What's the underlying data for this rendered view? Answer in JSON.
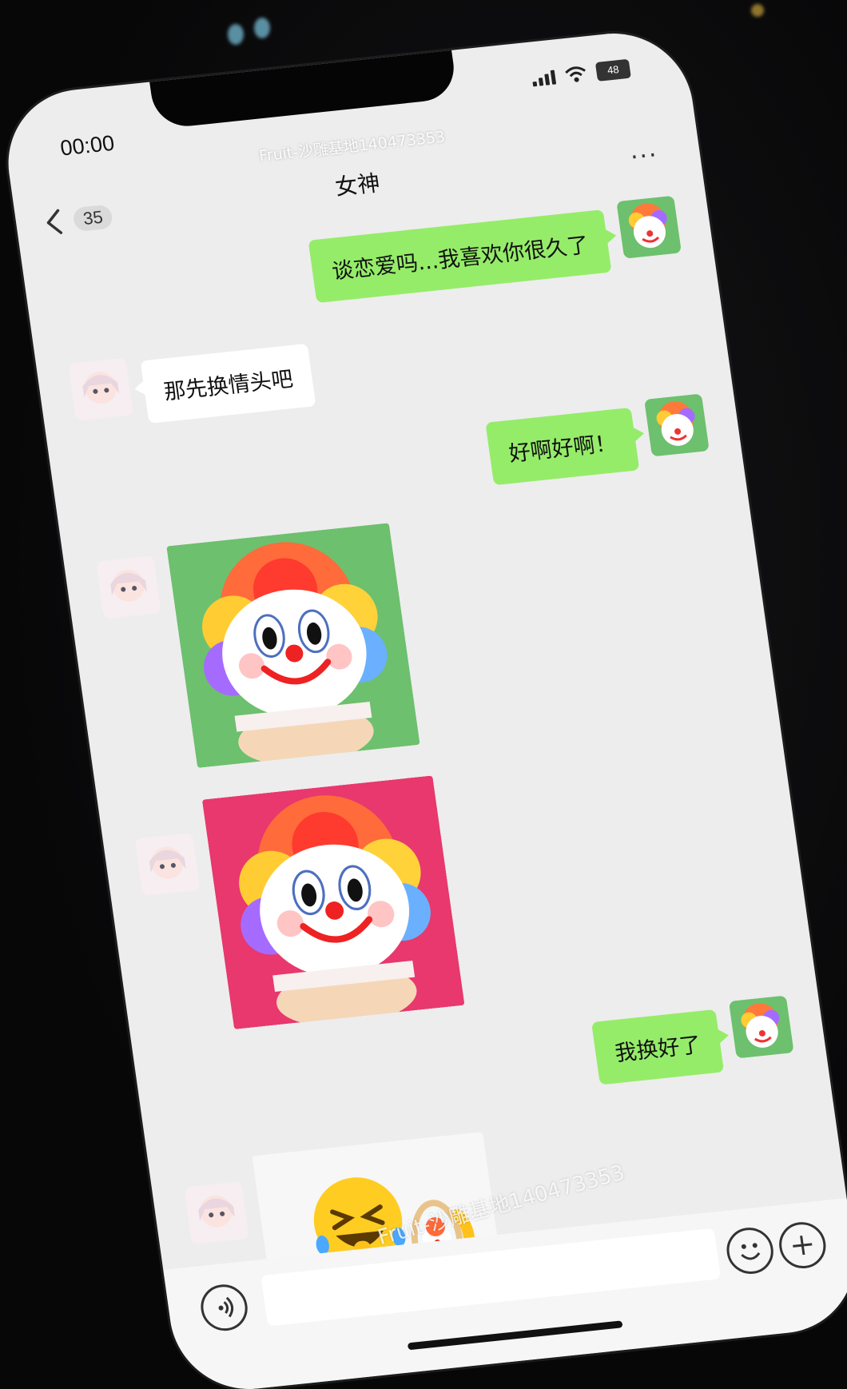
{
  "status": {
    "time": "00:00",
    "battery": "48"
  },
  "header": {
    "back_count": "35",
    "title": "女神",
    "more": "···"
  },
  "watermark": {
    "top": "Fruit-沙雕基地140473353",
    "bottom": "Fruit-沙雕基地140473353"
  },
  "messages": [
    {
      "from": "me",
      "type": "text",
      "text": "谈恋爱吗...我喜欢你很久了"
    },
    {
      "from": "her",
      "type": "text",
      "text": "那先换情头吧"
    },
    {
      "from": "me",
      "type": "text",
      "text": "好啊好啊！"
    },
    {
      "from": "her",
      "type": "sticker",
      "sticker": "clown-avatar-green-background"
    },
    {
      "from": "her",
      "type": "sticker",
      "sticker": "clown-avatar-pink-background"
    },
    {
      "from": "me",
      "type": "text",
      "text": "我换好了"
    },
    {
      "from": "her",
      "type": "sticker",
      "sticker": "laughing-pointing-emoji-with-clown-mirror"
    }
  ],
  "input": {
    "icons": [
      "voice-icon",
      "emoji-icon",
      "plus-icon"
    ]
  },
  "colors": {
    "chat_bg": "#ededed",
    "my_bubble": "#95ec69",
    "her_bubble": "#ffffff",
    "sticker_green": "#6dc06e",
    "sticker_pink": "#e8386e"
  }
}
